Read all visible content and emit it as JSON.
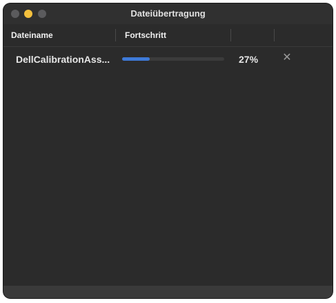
{
  "window": {
    "title": "Dateiübertragung"
  },
  "table": {
    "columns": {
      "name": "Dateiname",
      "progress": "Fortschritt"
    },
    "rows": [
      {
        "filename": "DellCalibrationAss...",
        "progress_fraction": 0.27,
        "percent_text": "27%",
        "cancel_icon": "close-icon"
      }
    ]
  },
  "colors": {
    "progress_fill": "#3e7ad8",
    "window_bg": "#2b2b2b",
    "traffic_min": "#f4c03d"
  }
}
